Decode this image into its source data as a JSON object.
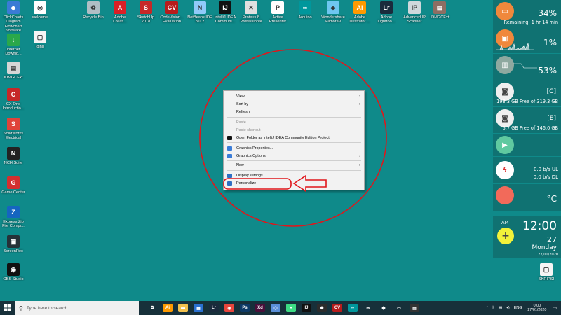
{
  "desktop": {
    "icons_left": [
      {
        "label": "ClickCharts\nDiagram\nFlowchart\nSoftware",
        "color": "#3a7bd5",
        "glyph": "◆"
      },
      {
        "label": "Internet\nDownlo...",
        "color": "#2aa84a",
        "glyph": "↓"
      },
      {
        "label": "IDMGCExt",
        "color": "#d6d6d6",
        "glyph": "▤"
      },
      {
        "label": "CX-One\nIntroductio...",
        "color": "#c62828",
        "glyph": "C"
      },
      {
        "label": "SolidWorks\nElectrical",
        "color": "#e0443a",
        "glyph": "S"
      },
      {
        "label": "NCH Suite",
        "color": "#222222",
        "glyph": "N"
      },
      {
        "label": "Game Center",
        "color": "#d32f2f",
        "glyph": "G"
      },
      {
        "label": "Express Zip\nFile Compr...",
        "color": "#1565c0",
        "glyph": "Z"
      },
      {
        "label": "ScreenRec",
        "color": "#263238",
        "glyph": "▣"
      },
      {
        "label": "OBS Studio",
        "color": "#111111",
        "glyph": "◉"
      }
    ],
    "icons_col2": [
      {
        "label": "welcome",
        "color": "#ffffff",
        "glyph": "◎"
      },
      {
        "label": "iding",
        "color": "#f5f5f5",
        "glyph": "▢"
      }
    ],
    "icons_top": [
      {
        "label": "Recycle Bin",
        "color": "#b0bec5",
        "glyph": "♻"
      },
      {
        "label": "Adobe\nCreati...",
        "color": "#da1f26",
        "glyph": "A"
      },
      {
        "label": "SketchUp\n2018",
        "color": "#c62828",
        "glyph": "S"
      },
      {
        "label": "CodeVision...\nEvaluation",
        "color": "#b71c1c",
        "glyph": "CV"
      },
      {
        "label": "NetBeans IDE\n8.0.2",
        "color": "#90caf9",
        "glyph": "N"
      },
      {
        "label": "IntelliJ IDEA\nCommuni...",
        "color": "#111111",
        "glyph": "IJ"
      },
      {
        "label": "Proteus 8\nProfessional",
        "color": "#e0e0e0",
        "glyph": "✕"
      },
      {
        "label": "Active\nPresenter",
        "color": "#ffffff",
        "glyph": "P"
      },
      {
        "label": "Arduino",
        "color": "#00979c",
        "glyph": "∞"
      },
      {
        "label": "Wondershare\nFilmora9",
        "color": "#6ec6f0",
        "glyph": "◈"
      },
      {
        "label": "Adobe\nIllustrator ...",
        "color": "#ff9a00",
        "glyph": "Ai"
      },
      {
        "label": "Adobe\nLightroo...",
        "color": "#1a2b3c",
        "glyph": "Lr"
      },
      {
        "label": "Advanced IP\nScanner",
        "color": "#cfd8dc",
        "glyph": "IP"
      },
      {
        "label": "IDMGCExt",
        "color": "#8d6e63",
        "glyph": "▤"
      }
    ],
    "icons_right": [
      {
        "label": "SKRIPSI",
        "color": "#f5f5f5",
        "glyph": "▢"
      }
    ]
  },
  "context_menu": {
    "items": [
      {
        "label": "View",
        "has_arrow": true,
        "disabled": false,
        "icon": null
      },
      {
        "label": "Sort by",
        "has_arrow": true,
        "disabled": false,
        "icon": null
      },
      {
        "label": "Refresh",
        "has_arrow": false,
        "disabled": false,
        "icon": null
      },
      {
        "label": "Paste",
        "has_arrow": false,
        "disabled": true,
        "icon": null
      },
      {
        "label": "Paste shortcut",
        "has_arrow": false,
        "disabled": true,
        "icon": null
      },
      {
        "label": "Open Folder as IntelliJ IDEA Community Edition Project",
        "has_arrow": false,
        "disabled": false,
        "icon": "#111111"
      },
      {
        "label": "Graphics Properties...",
        "has_arrow": false,
        "disabled": false,
        "icon": "#3b7dd8"
      },
      {
        "label": "Graphics Options",
        "has_arrow": true,
        "disabled": false,
        "icon": "#3b7dd8"
      },
      {
        "label": "New",
        "has_arrow": true,
        "disabled": false,
        "icon": null
      },
      {
        "label": "Display settings",
        "has_arrow": false,
        "disabled": false,
        "icon": "#2d6fc4"
      },
      {
        "label": "Personalize",
        "has_arrow": false,
        "disabled": false,
        "icon": "#2d6fc4"
      }
    ],
    "arrow_glyph": "›"
  },
  "annotations": {
    "ellipse_color": "#e0161b",
    "arrow_color": "#e0161b"
  },
  "widgets": {
    "battery": {
      "value": "34%",
      "sub": "Remaining: 1 hr 14 min",
      "color": "#f0883c"
    },
    "cpu": {
      "value": "1%",
      "color": "#f0883c"
    },
    "ram": {
      "value": "53%",
      "color": "#8ea9a0"
    },
    "drive_c": {
      "label": "[C]:",
      "sub": "193.3 GB Free of 319.3 GB",
      "color": "#efefef"
    },
    "drive_e": {
      "label": "[E]:",
      "sub": "6.7 GB Free of 146.0 GB",
      "color": "#efefef"
    },
    "media": {
      "color": "#5fc9a0"
    },
    "network": {
      "up": "0.0 b/s  UL",
      "down": "0.0 b/s  DL",
      "color": "#ffffff"
    },
    "weather": {
      "value": "°C",
      "color": "#f26a5a"
    },
    "clock": {
      "ampm": "AM",
      "time": "12:00",
      "day": "27",
      "weekday": "Monday",
      "date": "27/01/2020",
      "add_color": "#f2f23a"
    }
  },
  "taskbar": {
    "search_placeholder": "Type here to search",
    "apps": [
      {
        "name": "task-view",
        "color": "#17303a",
        "glyph": "⧉"
      },
      {
        "name": "illustrator",
        "color": "#ff9a00",
        "glyph": "Ai"
      },
      {
        "name": "file-explorer",
        "color": "#f2c14e",
        "glyph": "▬"
      },
      {
        "name": "photos",
        "color": "#2a70d0",
        "glyph": "▦"
      },
      {
        "name": "lightroom",
        "color": "#1a2b3c",
        "glyph": "Lr"
      },
      {
        "name": "chrome",
        "color": "#e8453c",
        "glyph": "◉"
      },
      {
        "name": "photoshop",
        "color": "#0d3a66",
        "glyph": "Ps"
      },
      {
        "name": "xd",
        "color": "#4a0f3a",
        "glyph": "Xd"
      },
      {
        "name": "app-generic",
        "color": "#5a8fd8",
        "glyph": "⬡"
      },
      {
        "name": "android",
        "color": "#3ddc84",
        "glyph": "●"
      },
      {
        "name": "intellij",
        "color": "#111111",
        "glyph": "IJ"
      },
      {
        "name": "proteus",
        "color": "#2c2c2c",
        "glyph": "✺"
      },
      {
        "name": "codevision",
        "color": "#b71c1c",
        "glyph": "CV"
      },
      {
        "name": "arduino",
        "color": "#00979c",
        "glyph": "∞"
      },
      {
        "name": "mail",
        "color": "#17303a",
        "glyph": "✉"
      },
      {
        "name": "app-generic2",
        "color": "#17303a",
        "glyph": "⬢"
      },
      {
        "name": "app-generic3",
        "color": "#17303a",
        "glyph": "▭"
      },
      {
        "name": "recorder",
        "color": "#333333",
        "glyph": "▤"
      }
    ],
    "tray": {
      "lang": "ENG",
      "time": "0:00",
      "date": "27/01/2020"
    }
  }
}
